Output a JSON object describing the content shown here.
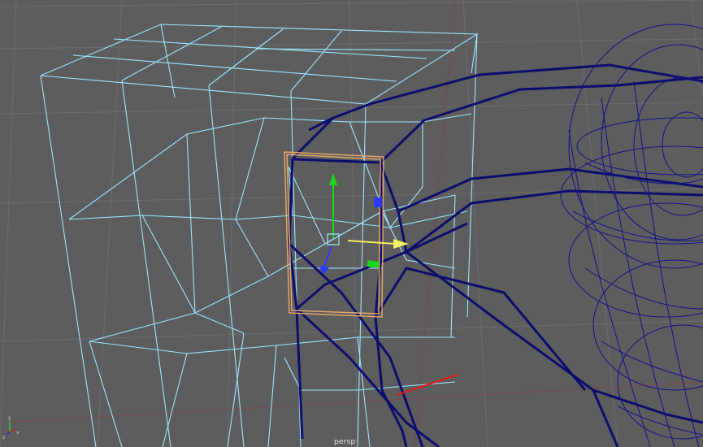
{
  "viewport": {
    "camera_label": "persp",
    "colors": {
      "background": "#5d5d5d",
      "grid": "#6c6c6c",
      "grid_axis": "#8f3b3b",
      "lattice": "#9be6ff",
      "curve_wire": "#0d0d6e",
      "selection": "#e8a96b",
      "axis_x": "#e61a1a",
      "axis_y": "#1aff1a",
      "axis_z": "#1a1aff",
      "move_x": "#f0f060",
      "move_y": "#19d619",
      "move_z": "#2a39ff"
    },
    "objects": [
      "lattice-deformer",
      "helmet-wireframe",
      "head-sphere-wireframe",
      "selected-lattice-point",
      "move-manipulator",
      "view-axis-indicator"
    ]
  }
}
